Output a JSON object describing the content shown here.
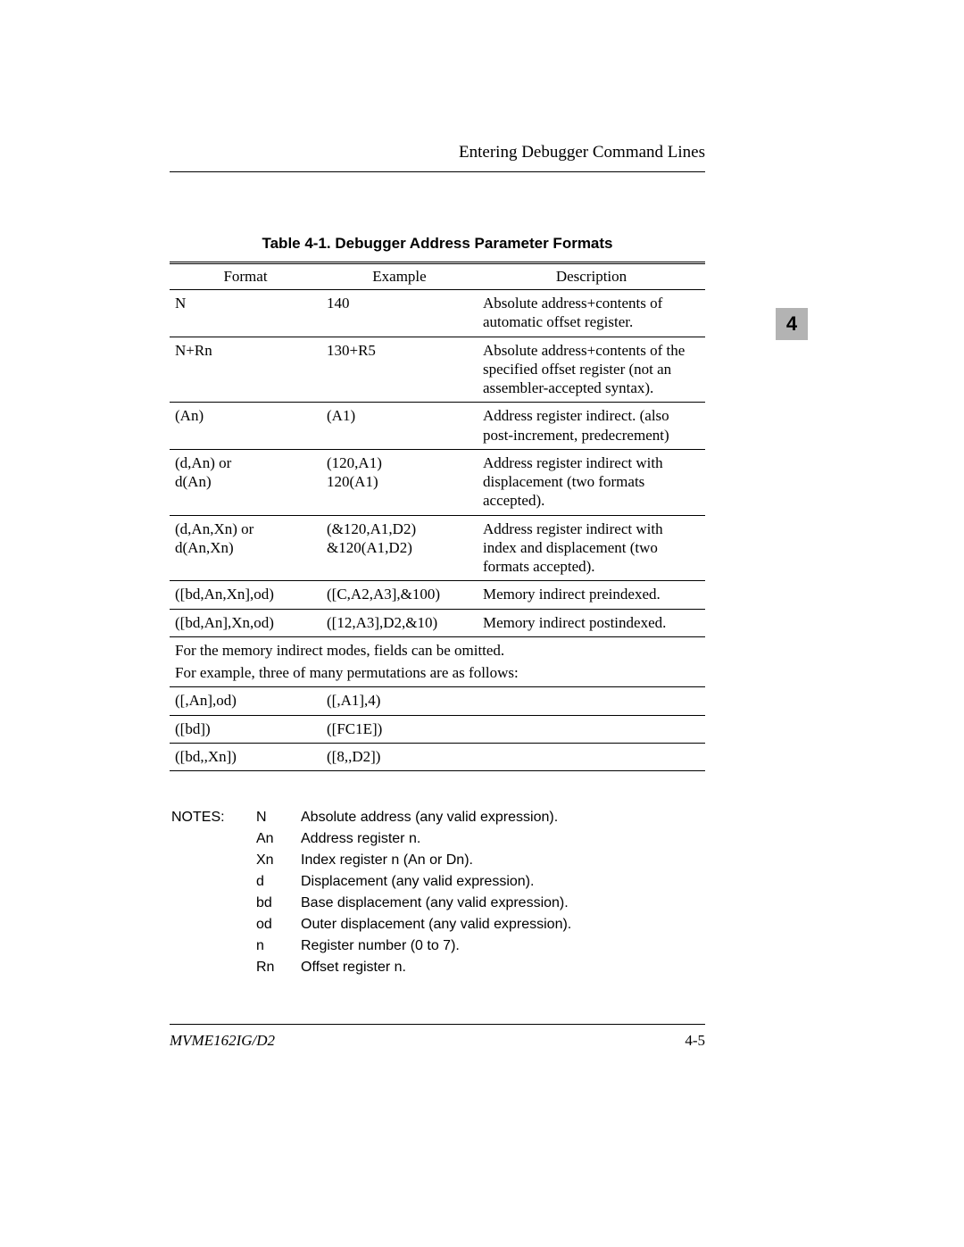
{
  "header": {
    "running_head": "Entering Debugger Command Lines",
    "chapter_tab": "4"
  },
  "table": {
    "caption": "Table 4-1.  Debugger Address Parameter Formats",
    "headers": {
      "format": "Format",
      "example": "Example",
      "description": "Description"
    },
    "rows": [
      {
        "format": "N",
        "example": "140",
        "description": "Absolute address+contents of automatic offset register."
      },
      {
        "format": "N+Rn",
        "example": "130+R5",
        "description": "Absolute address+contents of the specified offset register (not an assembler-accepted syntax)."
      },
      {
        "format": "(An)",
        "example": "(A1)",
        "description": "Address register indirect. (also post-increment, predecrement)"
      },
      {
        "format": "(d,An) or\nd(An)",
        "example": "(120,A1)\n120(A1)",
        "description": "Address register indirect with displacement (two formats accepted)."
      },
      {
        "format": "(d,An,Xn) or\nd(An,Xn)",
        "example": "(&120,A1,D2)\n&120(A1,D2)",
        "description": "Address register indirect with index and displacement (two formats accepted)."
      },
      {
        "format": "([bd,An,Xn],od)",
        "example": "([C,A2,A3],&100)",
        "description": "Memory indirect preindexed."
      },
      {
        "format": "([bd,An],Xn,od)",
        "example": "([12,A3],D2,&10)",
        "description": "Memory indirect postindexed."
      }
    ],
    "span_note_1": "For the memory indirect modes, fields can be omitted.",
    "span_note_2": "For example, three of many permutations are as follows:",
    "rows2": [
      {
        "format": "([,An],od)",
        "example": "([,A1],4)",
        "description": ""
      },
      {
        "format": "([bd])",
        "example": "([FC1E])",
        "description": ""
      },
      {
        "format": "([bd,,Xn])",
        "example": "([8,,D2])",
        "description": ""
      }
    ]
  },
  "notes": {
    "label": "NOTES:",
    "items": [
      {
        "sym": "N",
        "desc": "Absolute address (any valid expression)."
      },
      {
        "sym": "An",
        "desc": "Address register n."
      },
      {
        "sym": "Xn",
        "desc": "Index register n (An or Dn)."
      },
      {
        "sym": "d",
        "desc": "Displacement (any valid expression)."
      },
      {
        "sym": "bd",
        "desc": "Base displacement (any valid expression)."
      },
      {
        "sym": "od",
        "desc": "Outer displacement (any valid expression)."
      },
      {
        "sym": "n",
        "desc": "Register number (0 to 7)."
      },
      {
        "sym": "Rn",
        "desc": "Offset register n."
      }
    ]
  },
  "footer": {
    "doc_id": "MVME162IG/D2",
    "page_no": "4-5"
  }
}
